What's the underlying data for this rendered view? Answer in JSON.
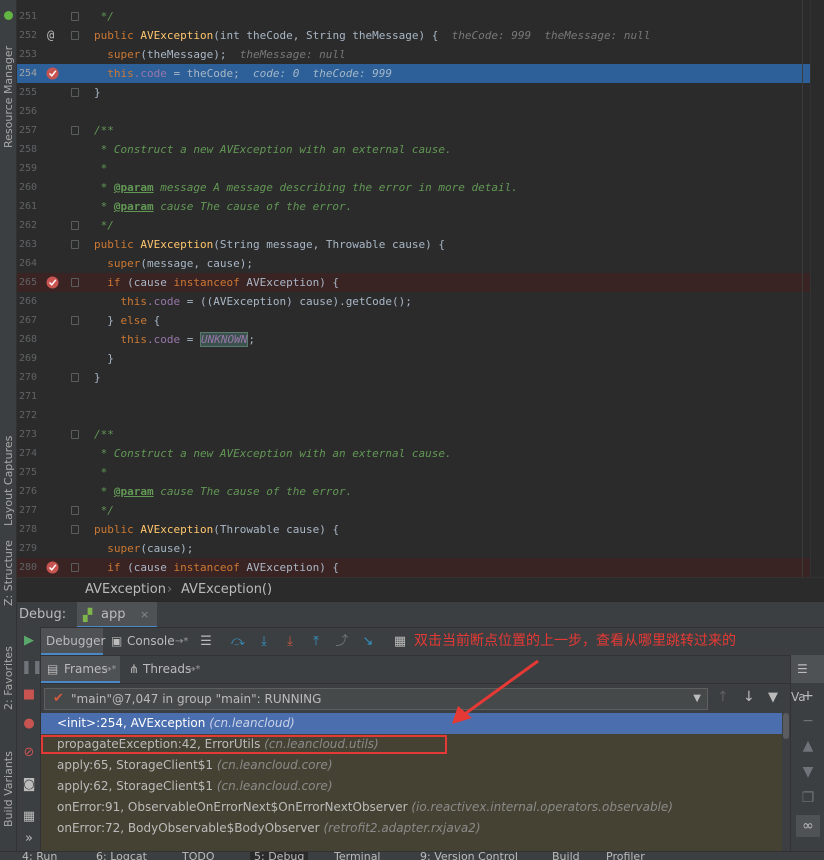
{
  "side_tabs": {
    "resource_manager": "Resource Manager",
    "layout_captures": "Layout Captures",
    "structure": "Z: Structure",
    "favorites": "2: Favorites",
    "build_variants": "Build Variants"
  },
  "editor": {
    "lines": [
      {
        "n": "251",
        "t": "comment",
        "text": " */"
      },
      {
        "n": "252",
        "t": "sig",
        "gutter": "@",
        "vis": "public",
        "name": "AVException",
        "params": "(int theCode, String theMessage) {",
        "inline": "theCode: 999  theMessage: null"
      },
      {
        "n": "253",
        "t": "call",
        "kw": "super",
        "rest": "(theMessage);",
        "inline": "theMessage: null"
      },
      {
        "n": "254",
        "t": "assign",
        "exec": true,
        "breakpoint": true,
        "pre": "this",
        "field": ".code",
        "rest": " = theCode;",
        "inline": "code: 0  theCode: 999"
      },
      {
        "n": "255",
        "t": "plain",
        "text": "}"
      },
      {
        "n": "256",
        "t": "blank"
      },
      {
        "n": "257",
        "t": "comment",
        "text": "/**"
      },
      {
        "n": "258",
        "t": "comment",
        "text": " * Construct a new AVException with an external cause."
      },
      {
        "n": "259",
        "t": "comment",
        "text": " *"
      },
      {
        "n": "260",
        "t": "doc",
        "tag": "@param",
        "text": " message A message describing the error in more detail."
      },
      {
        "n": "261",
        "t": "doc",
        "tag": "@param",
        "text": " cause The cause of the error."
      },
      {
        "n": "262",
        "t": "comment",
        "text": " */"
      },
      {
        "n": "263",
        "t": "sig",
        "vis": "public",
        "name": "AVException",
        "params": "(String message, Throwable cause) {"
      },
      {
        "n": "264",
        "t": "call",
        "kw": "super",
        "rest": "(message, cause);"
      },
      {
        "n": "265",
        "t": "if",
        "breakpoint": true,
        "text": "(cause instanceof AVException) {"
      },
      {
        "n": "266",
        "t": "assign2",
        "pre": "this",
        "field": ".code",
        "rest": " = ((AVException) cause).getCode();"
      },
      {
        "n": "267",
        "t": "else",
        "text": "} else {"
      },
      {
        "n": "268",
        "t": "assign3",
        "pre": "this",
        "field": ".code",
        "eq": " = ",
        "const": "UNKNOWN",
        "end": ";"
      },
      {
        "n": "269",
        "t": "plain2",
        "text": "}"
      },
      {
        "n": "270",
        "t": "plain",
        "text": "}"
      },
      {
        "n": "271",
        "t": "blank"
      },
      {
        "n": "272",
        "t": "blank"
      },
      {
        "n": "273",
        "t": "comment",
        "text": "/**"
      },
      {
        "n": "274",
        "t": "comment",
        "text": " * Construct a new AVException with an external cause."
      },
      {
        "n": "275",
        "t": "comment",
        "text": " *"
      },
      {
        "n": "276",
        "t": "doc",
        "tag": "@param",
        "text": " cause The cause of the error."
      },
      {
        "n": "277",
        "t": "comment",
        "text": " */"
      },
      {
        "n": "278",
        "t": "sig",
        "vis": "public",
        "name": "AVException",
        "params": "(Throwable cause) {"
      },
      {
        "n": "279",
        "t": "call",
        "kw": "super",
        "rest": "(cause);"
      },
      {
        "n": "280",
        "t": "if",
        "breakpoint": true,
        "text": "(cause instanceof AVException) {"
      }
    ]
  },
  "breadcrumb": {
    "class": "AVException",
    "method": "AVException()"
  },
  "debug": {
    "label": "Debug:",
    "config": "app",
    "tabs": {
      "debugger": "Debugger",
      "console": "Console"
    },
    "annotation": "双击当前断点位置的上一步，查看从哪里跳转过来的",
    "frames_tab": "Frames",
    "threads_tab": "Threads",
    "thread_value": "\"main\"@7,047 in group \"main\": RUNNING",
    "frames": [
      {
        "method": "<init>:254, AVException",
        "pkg": "(cn.leancloud)",
        "selected": true
      },
      {
        "method": "propagateException:42, ErrorUtils",
        "pkg": "(cn.leancloud.utils)",
        "boxed": true
      },
      {
        "method": "apply:65, StorageClient$1",
        "pkg": "(cn.leancloud.core)"
      },
      {
        "method": "apply:62, StorageClient$1",
        "pkg": "(cn.leancloud.core)"
      },
      {
        "method": "onError:91, ObservableOnErrorNext$OnErrorNextObserver",
        "pkg": "(io.reactivex.internal.operators.observable)"
      },
      {
        "method": "onError:72, BodyObservable$BodyObserver",
        "pkg": "(retrofit2.adapter.rxjava2)"
      }
    ],
    "variables_tab": "Va"
  },
  "bottom_tabs": [
    "4: Run",
    "6: Logcat",
    "TODO",
    "5: Debug",
    "Terminal",
    "9: Version Control",
    "Build",
    "Profiler"
  ],
  "colors": {
    "accent": "#4b6eaf",
    "annotation": "#e53935",
    "breakpoint": "#c75450"
  }
}
